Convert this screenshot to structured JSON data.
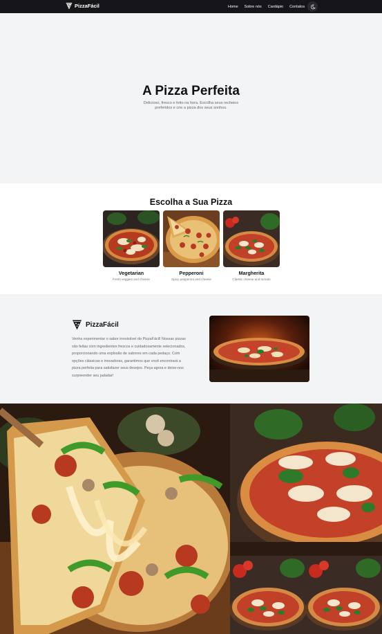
{
  "nav": {
    "brand": "PizzaFácil",
    "links": [
      "Home",
      "Sobre nós",
      "Cardápio",
      "Contatos"
    ]
  },
  "hero": {
    "title": "A Pizza Perfeita",
    "subtitle": "Delicioso, fresco e feito na hora. Escolha seus recheios preferidos e crie a pizza dos seus sonhos."
  },
  "choose": {
    "title": "Escolha a Sua Pizza",
    "pizzas": [
      {
        "name": "Vegetarian",
        "desc": "Fresh veggies and cheese"
      },
      {
        "name": "Pepperoni",
        "desc": "Spicy pepperoni and cheese"
      },
      {
        "name": "Margherita",
        "desc": "Classic cheese and tomato"
      }
    ]
  },
  "about": {
    "brand": "PizzaFácil",
    "text": "Venha experimentar o sabor irresistível do PizzaFácil! Nossas pizzas são feitas com ingredientes frescos e cuidadosamente selecionados, proporcionando uma explosão de sabores em cada pedaço. Com opções clássicas e inovadoras, garantimos que você encontrará a pizza perfeita para satisfazer seus desejos. Peça agora e deixe-nos surpreender seu paladar!"
  },
  "colors": {
    "nav_bg": "#15151a",
    "section_bg": "#f3f4f6"
  },
  "icons": {
    "brand": "pizza-slice-icon",
    "theme_toggle": "moon-icon"
  }
}
